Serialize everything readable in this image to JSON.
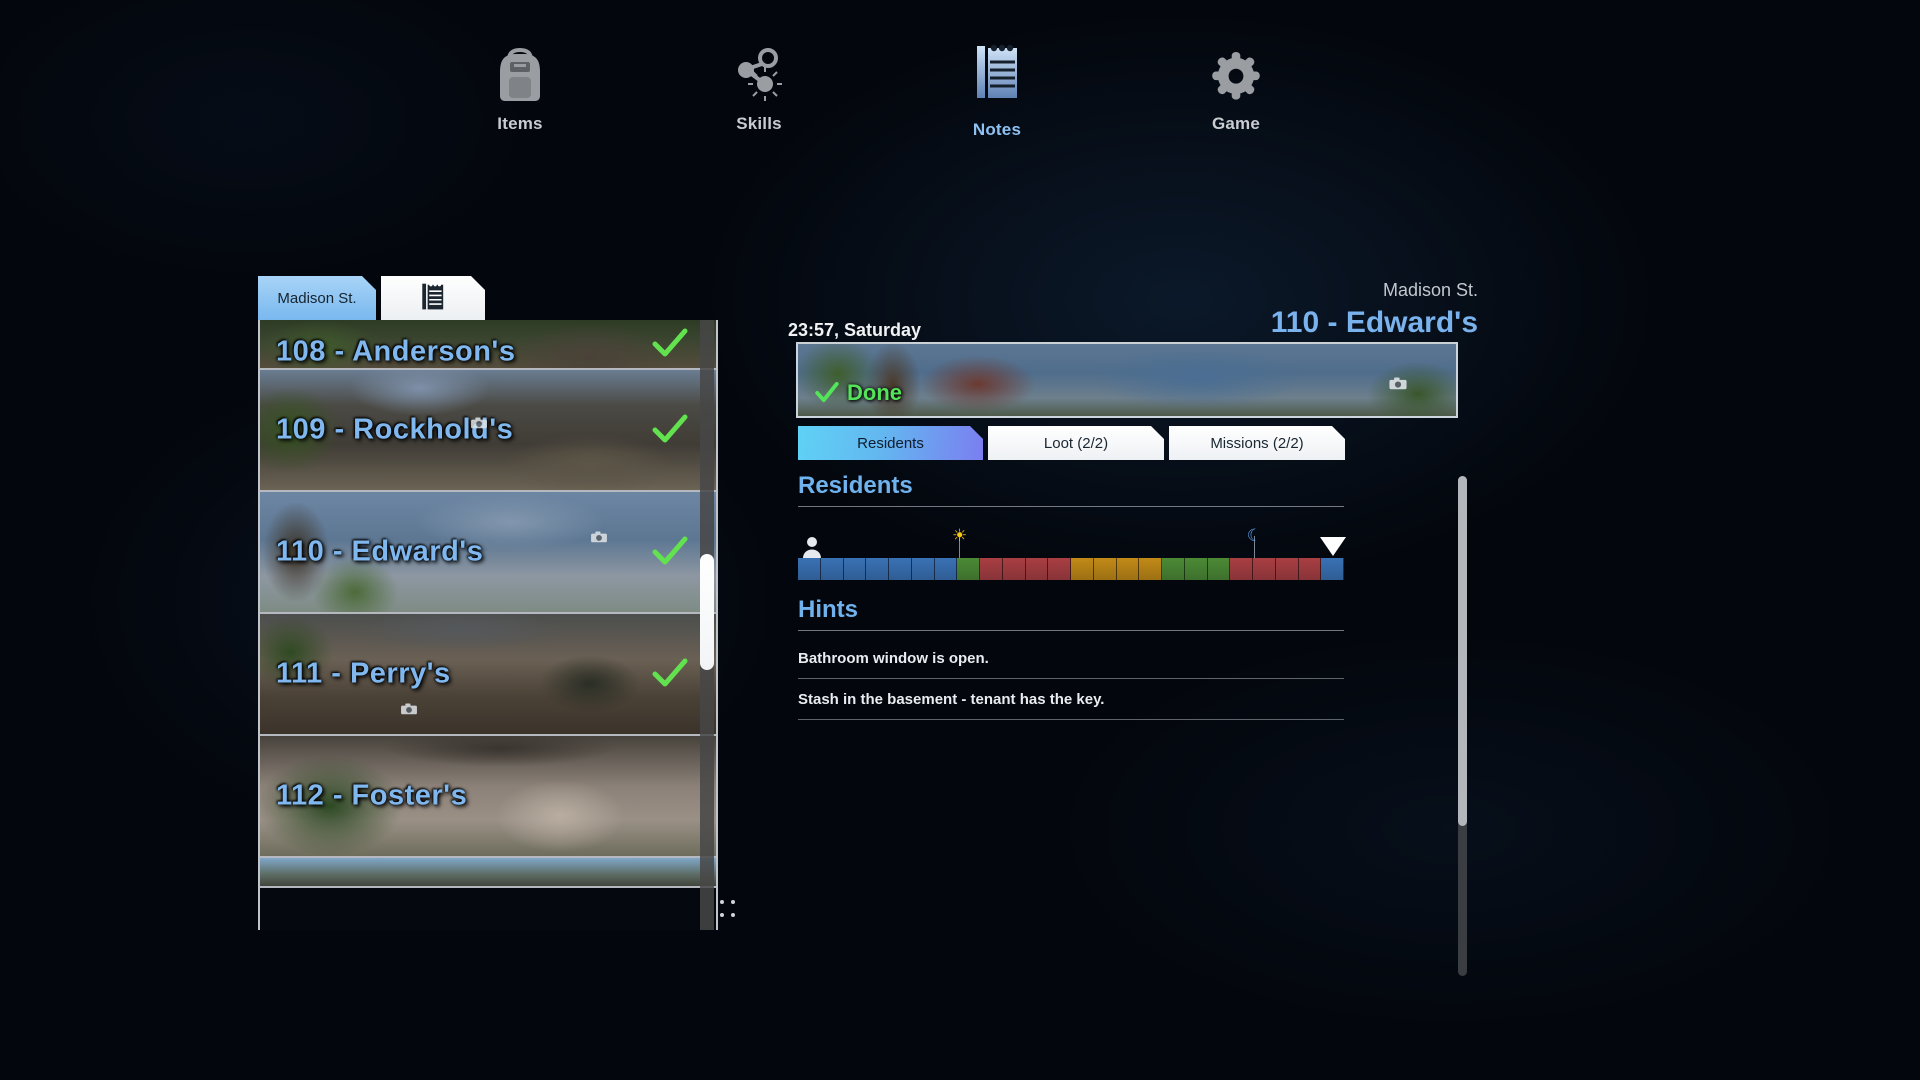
{
  "topnav": {
    "items": [
      {
        "label": "Items",
        "icon": "backpack-icon",
        "active": false
      },
      {
        "label": "Skills",
        "icon": "skills-node-icon",
        "active": false
      },
      {
        "label": "Notes",
        "icon": "notepad-icon",
        "active": true
      },
      {
        "label": "Game",
        "icon": "gear-icon",
        "active": false
      }
    ]
  },
  "left_panel": {
    "tabs": [
      {
        "label": "Madison St.",
        "style": "blue",
        "active": true
      },
      {
        "label": "",
        "icon": "notepad-icon",
        "style": "white",
        "active": false
      }
    ],
    "houses": [
      {
        "title": "108 - Anderson's",
        "done": true,
        "camera": false
      },
      {
        "title": "109 - Rockhold's",
        "done": true,
        "camera": true
      },
      {
        "title": "110 - Edward's",
        "done": true,
        "camera": true
      },
      {
        "title": "111 - Perry's",
        "done": true,
        "camera": true
      },
      {
        "title": "112 - Foster's",
        "done": false,
        "camera": false
      },
      {
        "title": "",
        "done": false,
        "camera": false
      }
    ],
    "scroll_position_pct": 62
  },
  "right_panel": {
    "clock": "23:57, Saturday",
    "street": "Madison St.",
    "house": "110 - Edward's",
    "status_label": "Done",
    "tabs": [
      {
        "label": "Residents",
        "active": true
      },
      {
        "label": "Loot (2/2)",
        "active": false
      },
      {
        "label": "Missions (2/2)",
        "active": false
      }
    ],
    "residents_heading": "Residents",
    "hints_heading": "Hints",
    "hints": [
      "Bathroom window is open.",
      "Stash in the basement - tenant has the key."
    ],
    "scroll_thumb_pct": 70
  },
  "schedule": {
    "hours": 24,
    "segments": [
      "#3a72b5",
      "#3a72b5",
      "#3a72b5",
      "#3a72b5",
      "#3a72b5",
      "#3a72b5",
      "#3a72b5",
      "#4c8a35",
      "#a93f43",
      "#a93f43",
      "#a93f43",
      "#a93f43",
      "#c28a16",
      "#c28a16",
      "#c28a16",
      "#c28a16",
      "#4c8a35",
      "#4c8a35",
      "#4c8a35",
      "#a93f43",
      "#a93f43",
      "#a93f43",
      "#a93f43",
      "#3a72b5"
    ],
    "markers": [
      {
        "name": "person-icon",
        "position_pct": 1
      },
      {
        "name": "sun-icon",
        "glyph": "☀",
        "position_pct": 29.5
      },
      {
        "name": "moon-icon",
        "glyph": "☾",
        "position_pct": 83.5
      },
      {
        "name": "current-time-cursor",
        "position_pct": 98
      }
    ]
  },
  "colors": {
    "accent_blue": "#79b2ec",
    "done_green": "#53e45a",
    "tab_active_from": "#5fd2f5",
    "tab_active_to": "#7b7ef0",
    "panel_border": "#e1e6ec"
  }
}
